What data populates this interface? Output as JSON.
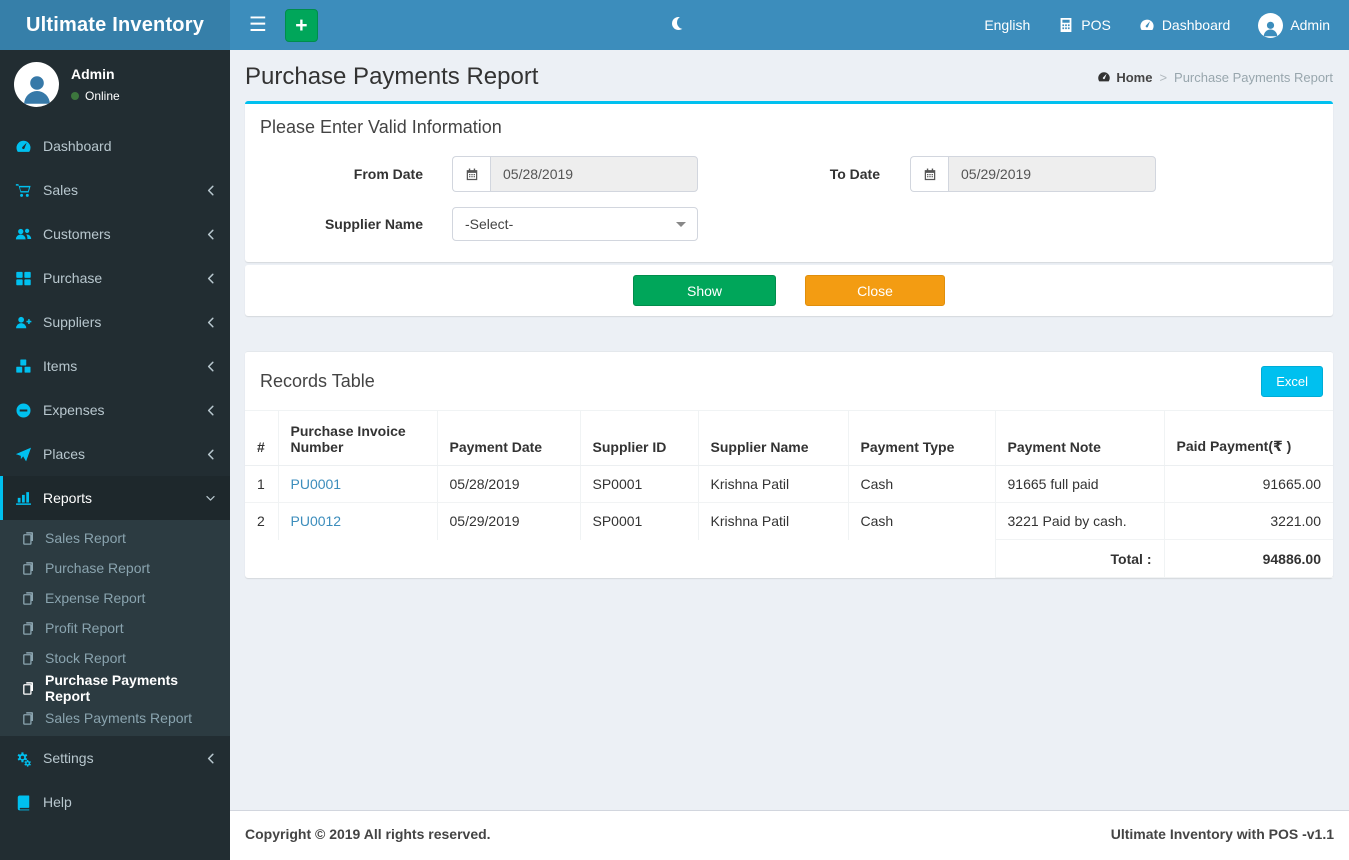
{
  "colors": {
    "navbar_blue": "#3c8dbc",
    "logo_blue": "#367fa9",
    "sidebar_dark": "#222d32",
    "accent_cyan": "#00c0ef",
    "success_green": "#00a65a",
    "warning_orange": "#f39c12",
    "link_blue": "#3c8dbc",
    "page_bg": "#ecf0f5"
  },
  "navbar": {
    "brand": "Ultimate Inventory",
    "language": "English",
    "pos": "POS",
    "dashboard": "Dashboard",
    "user": "Admin"
  },
  "sidebar": {
    "user_name": "Admin",
    "user_status": "Online",
    "items": [
      {
        "label": "Dashboard"
      },
      {
        "label": "Sales"
      },
      {
        "label": "Customers"
      },
      {
        "label": "Purchase"
      },
      {
        "label": "Suppliers"
      },
      {
        "label": "Items"
      },
      {
        "label": "Expenses"
      },
      {
        "label": "Places"
      },
      {
        "label": "Reports"
      },
      {
        "label": "Settings"
      },
      {
        "label": "Help"
      }
    ],
    "reports_submenu": [
      {
        "label": "Sales Report"
      },
      {
        "label": "Purchase Report"
      },
      {
        "label": "Expense Report"
      },
      {
        "label": "Profit Report"
      },
      {
        "label": "Stock Report"
      },
      {
        "label": "Purchase Payments Report"
      },
      {
        "label": "Sales Payments Report"
      }
    ]
  },
  "page": {
    "title": "Purchase Payments Report",
    "breadcrumb": {
      "home": "Home",
      "current": "Purchase Payments Report"
    }
  },
  "filter": {
    "title": "Please Enter Valid Information",
    "from_label": "From Date",
    "from_value": "05/28/2019",
    "to_label": "To Date",
    "to_value": "05/29/2019",
    "supplier_label": "Supplier Name",
    "supplier_value": "-Select-",
    "show": "Show",
    "close": "Close"
  },
  "records": {
    "title": "Records Table",
    "excel": "Excel",
    "columns": [
      "#",
      "Purchase Invoice Number",
      "Payment Date",
      "Supplier ID",
      "Supplier Name",
      "Payment Type",
      "Payment Note",
      "Paid Payment(₹ )"
    ],
    "rows": [
      {
        "num": "1",
        "invoice": "PU0001",
        "date": "05/28/2019",
        "supplier_id": "SP0001",
        "supplier_name": "Krishna Patil",
        "type": "Cash",
        "note": "91665 full paid",
        "paid": "91665.00"
      },
      {
        "num": "2",
        "invoice": "PU0012",
        "date": "05/29/2019",
        "supplier_id": "SP0001",
        "supplier_name": "Krishna Patil",
        "type": "Cash",
        "note": "3221 Paid by cash.",
        "paid": "3221.00"
      }
    ],
    "total_label": "Total :",
    "total_value": "94886.00"
  },
  "footer": {
    "left": "Copyright © 2019 All rights reserved.",
    "right": "Ultimate Inventory with POS -v1.1"
  }
}
